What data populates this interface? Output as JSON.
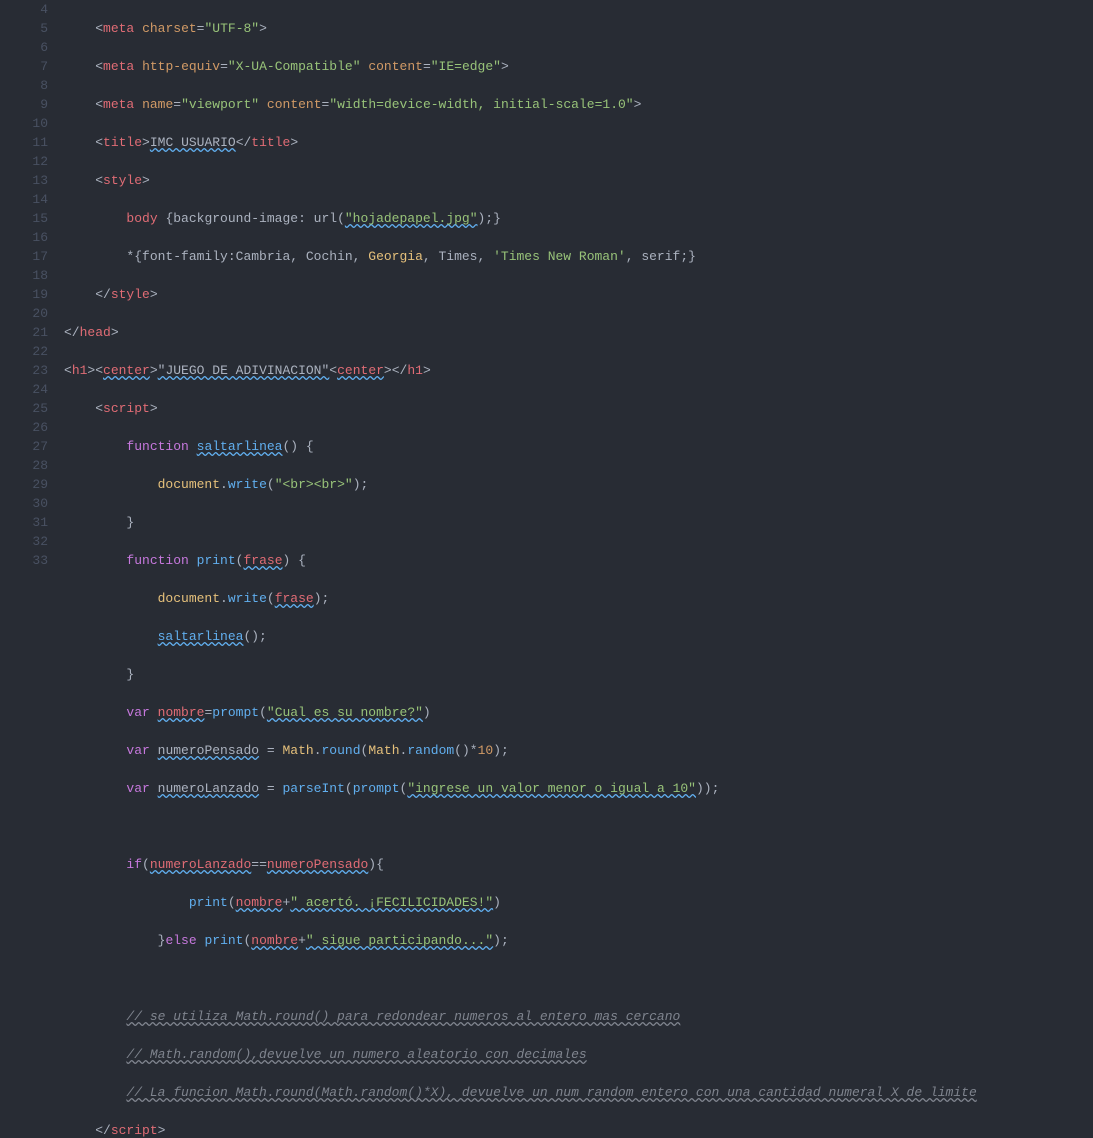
{
  "gutter": {
    "lines": [
      "4",
      "5",
      "6",
      "7",
      "8",
      "9",
      "10",
      "11",
      "12",
      "13",
      "14",
      "15",
      "16",
      "17",
      "18",
      "19",
      "20",
      "21",
      "22",
      "23",
      "24",
      "25",
      "26",
      "27",
      "28",
      "29",
      "30",
      "31",
      "32",
      "33"
    ]
  },
  "code": {
    "l4_meta": "meta",
    "l4_charset": "charset",
    "l4_charset_val": "\"UTF-8\"",
    "l5_meta": "meta",
    "l5_httpequiv": "http-equiv",
    "l5_httpequiv_val": "\"X-UA-Compatible\"",
    "l5_content": "content",
    "l5_content_val": "\"IE=edge\"",
    "l6_meta": "meta",
    "l6_name": "name",
    "l6_name_val": "\"viewport\"",
    "l6_content": "content",
    "l6_content_val": "\"width=device-width, initial-scale=1.0\"",
    "l7_title": "title",
    "l7_title_text": "IMC USUARIO",
    "l8_style": "style",
    "l9_body": "body",
    "l9_rule": " {background-image: url(",
    "l9_url": "\"hojadepapel.jpg\"",
    "l9_end": ");}",
    "l10_rule": "*{font-family:Cambria, Cochin, ",
    "l10_georgia": "Georgia",
    "l10_rule2": ", Times, ",
    "l10_tnr": "'Times New Roman'",
    "l10_rule3": ", serif;}",
    "l11_style_close": "style",
    "l12_head": "head",
    "l13_h1": "h1",
    "l13_center": "center",
    "l13_text": "\"JUEGO DE ADIVINACION\"",
    "l14_script": "script",
    "l15_function": "function",
    "l15_name": "saltarlinea",
    "l15_params": "() {",
    "l16_doc": "document",
    "l16_write": "write",
    "l16_arg": "\"<br><br>\"",
    "l17_close": "}",
    "l18_function": "function",
    "l18_name": "print",
    "l18_param": "frase",
    "l19_doc": "document",
    "l19_write": "write",
    "l19_arg": "frase",
    "l20_call": "saltarlinea",
    "l21_close": "}",
    "l22_var": "var",
    "l22_name": "nombre",
    "l22_prompt": "prompt",
    "l22_arg": "\"Cual es su nombre?\"",
    "l23_var": "var",
    "l23_name": "numeroPensado",
    "l23_math": "Math",
    "l23_round": "round",
    "l23_math2": "Math",
    "l23_random": "random",
    "l23_num": "10",
    "l24_var": "var",
    "l24_name": "numeroLanzado",
    "l24_parseint": "parseInt",
    "l24_prompt": "prompt",
    "l24_arg": "\"ingrese un valor menor o igual a 10\"",
    "l26_if": "if",
    "l26_v1": "numeroLanzado",
    "l26_v2": "numeroPensado",
    "l27_print": "print",
    "l27_nombre": "nombre",
    "l27_str": "\" acertó. ¡FECILICIDADES!\"",
    "l28_else": "else",
    "l28_print": "print",
    "l28_nombre": "nombre",
    "l28_str": "\" sigue participando...\"",
    "l30_comment": "// se utiliza Math.round() para redondear numeros al entero mas cercano",
    "l31_comment": "// Math.random(),devuelve un numero aleatorio con decimales",
    "l32_comment": "// La funcion Math.round(Math.random()*X), devuelve un num random entero con una cantidad numeral X de limite",
    "l33_script_close": "script"
  }
}
